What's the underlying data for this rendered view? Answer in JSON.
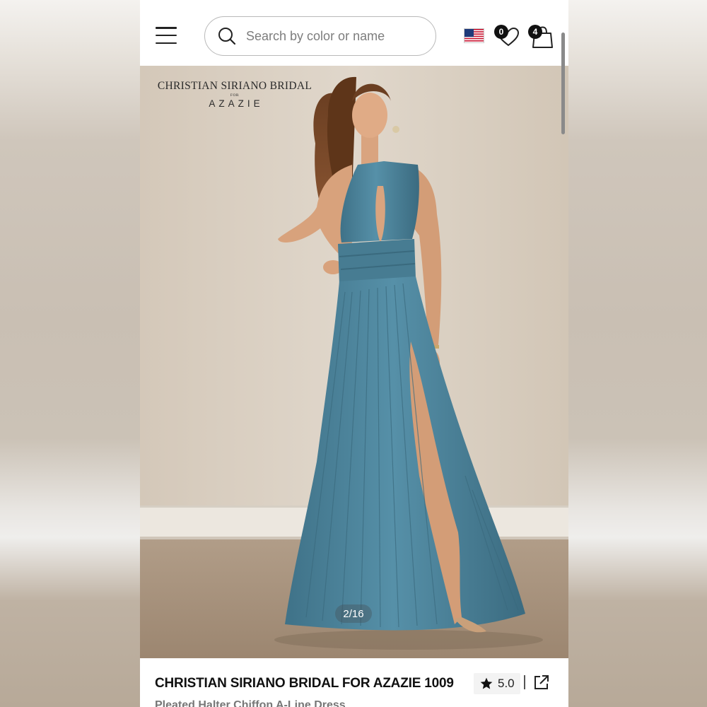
{
  "header": {
    "search_placeholder": "Search by color or name",
    "wishlist_count": "0",
    "cart_count": "4"
  },
  "hero": {
    "brand_line1": "CHRISTIAN SIRIANO BRIDAL",
    "brand_line2": "FOR",
    "brand_line3": "AZAZIE",
    "image_counter": "2/16"
  },
  "product": {
    "title": "CHRISTIAN SIRIANO BRIDAL FOR AZAZIE 1009",
    "rating": "5.0",
    "subtitle": "Pleated Halter Chiffon A-Line Dress"
  },
  "colors": {
    "dress": "#4a7f95",
    "wall": "#d9cfc2",
    "floor": "#a8927c"
  }
}
